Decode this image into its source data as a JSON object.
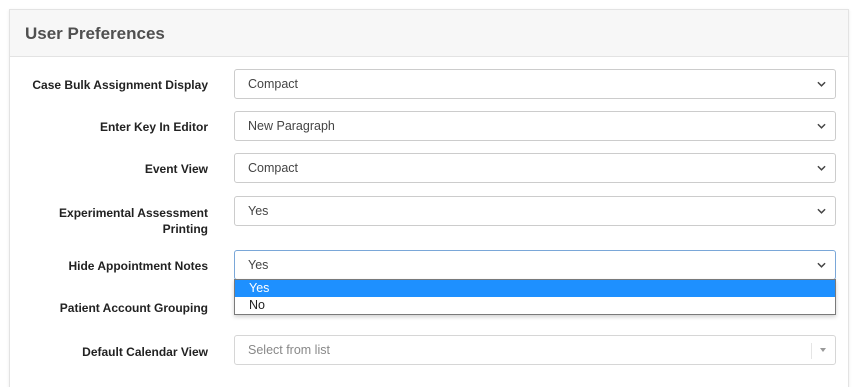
{
  "panel": {
    "title": "User Preferences"
  },
  "settings": [
    {
      "label": "Case Bulk Assignment Display",
      "value": "Compact"
    },
    {
      "label": "Enter Key In Editor",
      "value": "New Paragraph"
    },
    {
      "label": "Event View",
      "value": "Compact"
    },
    {
      "label": "Experimental Assessment Printing",
      "value": "Yes"
    },
    {
      "label": "Hide Appointment Notes",
      "value": "Yes"
    },
    {
      "label": "Patient Account Grouping",
      "value": ""
    },
    {
      "label": "Default Calendar View",
      "value": "",
      "placeholder": "Select from list"
    }
  ],
  "dropdown": {
    "options": [
      "Yes",
      "No"
    ],
    "selected": "Yes"
  },
  "colors": {
    "highlight": "#1e90ff",
    "focus_border": "#7aa7d8",
    "header_bg": "#f7f7f7"
  },
  "icons": {
    "select_arrow": "chevron-down-icon",
    "placeholder_arrow": "caret-down-icon"
  }
}
